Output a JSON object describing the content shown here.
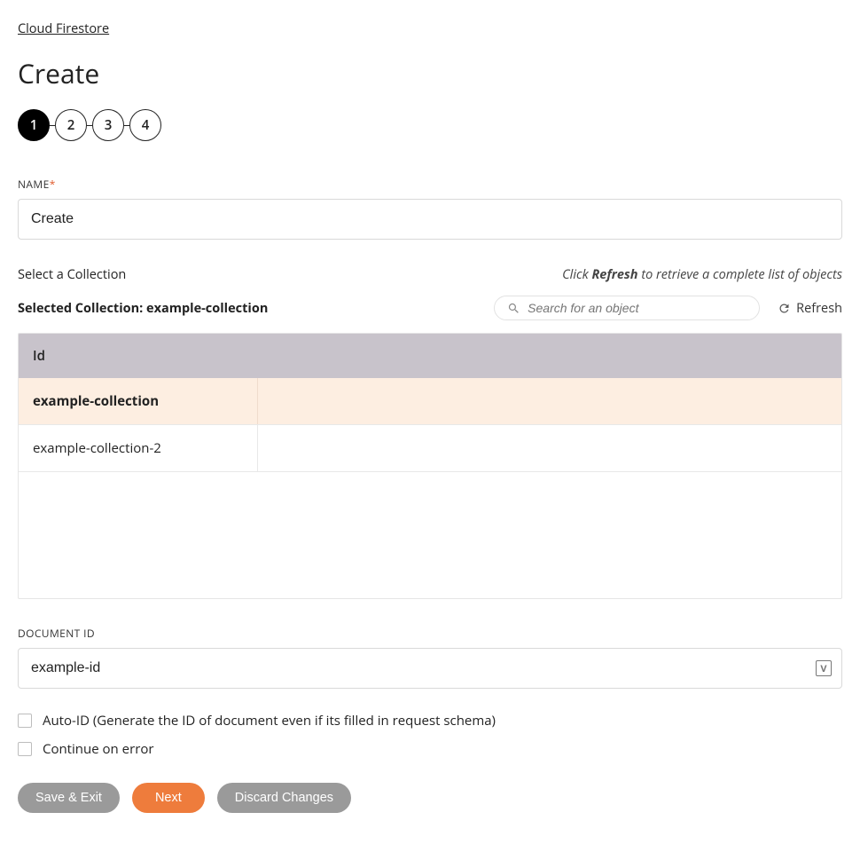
{
  "breadcrumb": "Cloud Firestore",
  "page_title": "Create",
  "stepper": {
    "steps": [
      "1",
      "2",
      "3",
      "4"
    ],
    "active": 0
  },
  "name": {
    "label": "NAME",
    "value": "Create"
  },
  "collection": {
    "select_label": "Select a Collection",
    "hint_pre": "Click ",
    "hint_strong": "Refresh",
    "hint_post": " to retrieve a complete list of objects",
    "selected_prefix": "Selected Collection: ",
    "selected_value": "example-collection",
    "search_placeholder": "Search for an object",
    "refresh_label": "Refresh",
    "header": "Id",
    "rows": [
      {
        "id": "example-collection",
        "selected": true
      },
      {
        "id": "example-collection-2",
        "selected": false
      }
    ]
  },
  "document": {
    "label": "DOCUMENT ID",
    "value": "example-id"
  },
  "checks": {
    "auto_id": "Auto-ID (Generate the ID of document even if its filled in request schema)",
    "continue_on_error": "Continue on error"
  },
  "buttons": {
    "save_exit": "Save & Exit",
    "next": "Next",
    "discard": "Discard Changes"
  }
}
